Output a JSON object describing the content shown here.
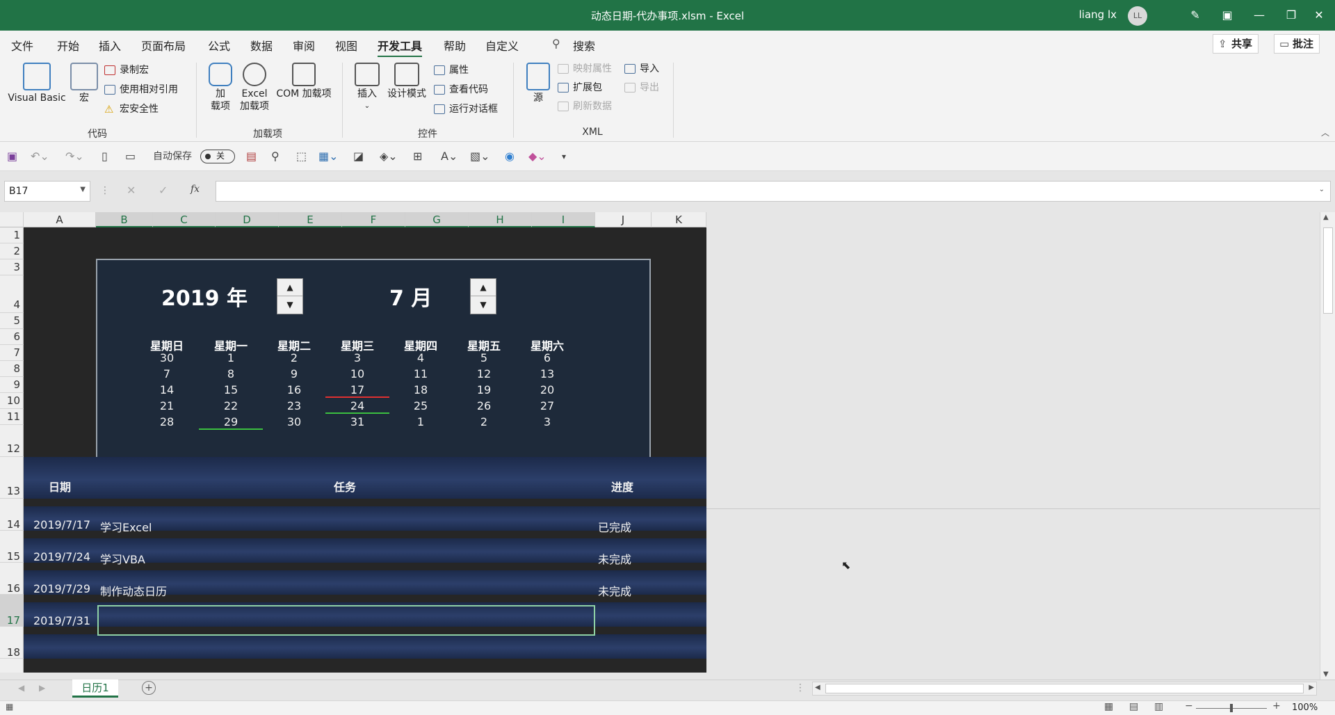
{
  "window": {
    "title": "动态日期-代办事项.xlsm - Excel",
    "user": "liang lx",
    "avatar": "LL"
  },
  "menu": {
    "tabs": [
      "文件",
      "开始",
      "插入",
      "页面布局",
      "公式",
      "数据",
      "审阅",
      "视图",
      "开发工具",
      "帮助",
      "自定义"
    ],
    "active_tab": "开发工具",
    "search": "搜索",
    "share": "共享",
    "comments": "批注"
  },
  "ribbon": {
    "code": {
      "label": "代码",
      "visual_basic": "Visual Basic",
      "macro": "宏",
      "record": "录制宏",
      "relative": "使用相对引用",
      "security": "宏安全性"
    },
    "addins": {
      "label": "加载项",
      "addin_1": "加",
      "addin_2": "载项",
      "excel_1": "Excel",
      "excel_2": "加载项",
      "com": "COM 加载项"
    },
    "controls": {
      "label": "控件",
      "insert": "插入",
      "design": "设计模式",
      "properties": "属性",
      "view_code": "查看代码",
      "run_dialog": "运行对话框"
    },
    "xml": {
      "label": "XML",
      "source": "源",
      "map_props": "映射属性",
      "expand": "扩展包",
      "refresh": "刷新数据",
      "import": "导入",
      "export": "导出"
    }
  },
  "qat": {
    "autosave": "自动保存",
    "autosave_state": "关"
  },
  "formula_bar": {
    "name_box": "B17",
    "formula": ""
  },
  "grid": {
    "columns": [
      "A",
      "B",
      "C",
      "D",
      "E",
      "F",
      "G",
      "H",
      "I",
      "J",
      "K"
    ],
    "rows": [
      "1",
      "2",
      "3",
      "4",
      "5",
      "6",
      "7",
      "8",
      "9",
      "10",
      "11",
      "12",
      "13",
      "14",
      "15",
      "16",
      "17",
      "18"
    ],
    "selected_column": "B",
    "selected_row": "17"
  },
  "calendar": {
    "year_text": "2019 年",
    "month_text": "7 月",
    "weekdays": [
      "星期日",
      "星期一",
      "星期二",
      "星期三",
      "星期四",
      "星期五",
      "星期六"
    ],
    "weeks": [
      [
        "30",
        "1",
        "2",
        "3",
        "4",
        "5",
        "6"
      ],
      [
        "7",
        "8",
        "9",
        "10",
        "11",
        "12",
        "13"
      ],
      [
        "14",
        "15",
        "16",
        "17",
        "18",
        "19",
        "20"
      ],
      [
        "21",
        "22",
        "23",
        "24",
        "25",
        "26",
        "27"
      ],
      [
        "28",
        "29",
        "30",
        "31",
        "1",
        "2",
        "3"
      ]
    ],
    "marked_red": [
      "17"
    ],
    "marked_green": [
      "24",
      "29"
    ],
    "colors": {
      "panel": "#1e2a3a",
      "red": "#e03030",
      "green": "#3cc040"
    }
  },
  "tasks": {
    "headers": {
      "date": "日期",
      "task": "任务",
      "progress": "进度"
    },
    "rows": [
      {
        "date": "2019/7/17",
        "task": "学习Excel",
        "progress": "已完成"
      },
      {
        "date": "2019/7/24",
        "task": "学习VBA",
        "progress": "未完成"
      },
      {
        "date": "2019/7/29",
        "task": "制作动态日历",
        "progress": "未完成"
      },
      {
        "date": "2019/7/31",
        "task": "",
        "progress": ""
      }
    ]
  },
  "sheets": {
    "tabs": [
      "日历1"
    ],
    "active": "日历1"
  },
  "status": {
    "zoom": "100%"
  },
  "theme": {
    "excel_green": "#217346"
  }
}
